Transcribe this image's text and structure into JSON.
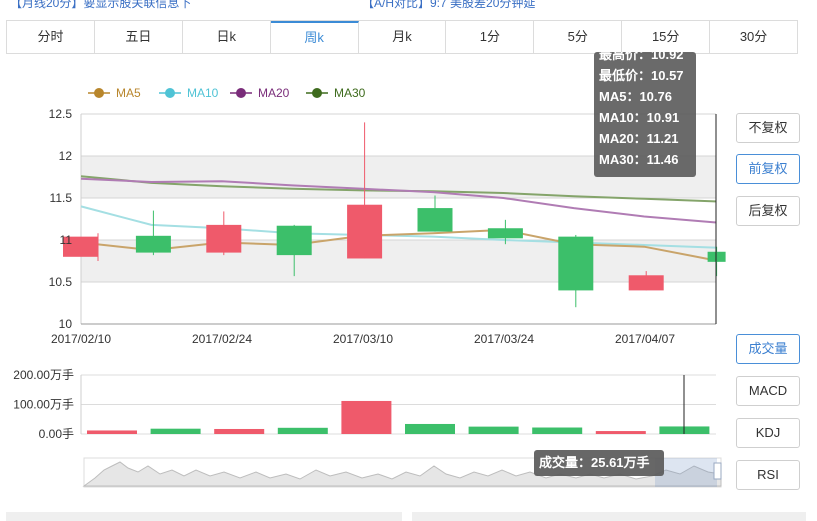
{
  "top_strip": {
    "left": "【月线20分】要显示股关联信息下",
    "right": "【A/H对比】9:7 美股差20分钟延"
  },
  "tabs": [
    "分时",
    "五日",
    "日k",
    "周k",
    "月k",
    "1分",
    "5分",
    "15分",
    "30分"
  ],
  "active_tab": 3,
  "side_buttons_top": [
    "不复权",
    "前复权",
    "后复权"
  ],
  "side_buttons_top_active": 1,
  "side_buttons_bottom": [
    "成交量",
    "MACD",
    "KDJ",
    "RSI"
  ],
  "side_buttons_bottom_active": 0,
  "tooltip": {
    "high": "最高价：10.92",
    "low": "最低价：10.57",
    "ma5": "MA5：10.76",
    "ma10": "MA10：10.91",
    "ma20": "MA20：11.21",
    "ma30": "MA30：11.46"
  },
  "volume_tooltip": "成交量：25.61万手",
  "colors": {
    "up": "#ef5a6b",
    "down": "#3cbf6a",
    "ma5": "#c9a46a",
    "ma10": "#a4dfe3",
    "ma20": "#b07cb4",
    "ma30": "#84a46a",
    "band": "#efefef"
  },
  "chart_data": {
    "type": "candlestick",
    "legend": [
      {
        "name": "MA5",
        "color": "#b8862c"
      },
      {
        "name": "MA10",
        "color": "#4fc3d5"
      },
      {
        "name": "MA20",
        "color": "#7a2d7a"
      },
      {
        "name": "MA30",
        "color": "#3e6b1d"
      }
    ],
    "legend_position": "top-left",
    "price_axis": {
      "ticks": [
        10,
        10.5,
        11,
        11.5,
        12,
        12.5
      ],
      "labels": [
        "10",
        "10.5",
        "11",
        "11.5",
        "12",
        "12.5"
      ],
      "ylim": [
        10,
        12.5
      ]
    },
    "date_labels": [
      "2017/02/10",
      "2017/02/24",
      "2017/03/10",
      "2017/03/24",
      "2017/04/07"
    ],
    "date_label_index": [
      0,
      2,
      4,
      6,
      8
    ],
    "candles": [
      {
        "open": 10.8,
        "close": 11.04,
        "high": 11.08,
        "low": 10.75
      },
      {
        "open": 11.05,
        "close": 10.85,
        "high": 11.35,
        "low": 10.82
      },
      {
        "open": 10.85,
        "close": 11.18,
        "high": 11.34,
        "low": 10.82
      },
      {
        "open": 11.17,
        "close": 10.82,
        "high": 11.18,
        "low": 10.57
      },
      {
        "open": 10.78,
        "close": 11.42,
        "high": 12.4,
        "low": 10.78
      },
      {
        "open": 11.38,
        "close": 11.1,
        "high": 11.53,
        "low": 11.1
      },
      {
        "open": 11.14,
        "close": 11.02,
        "high": 11.24,
        "low": 10.95
      },
      {
        "open": 11.04,
        "close": 10.4,
        "high": 11.06,
        "low": 10.2
      },
      {
        "open": 10.4,
        "close": 10.58,
        "high": 10.63,
        "low": 10.4
      },
      {
        "open": 10.86,
        "close": 10.74,
        "high": 10.92,
        "low": 10.57
      }
    ],
    "ma5": [
      10.97,
      10.88,
      10.97,
      10.94,
      11.05,
      11.08,
      11.12,
      10.95,
      10.92,
      10.76
    ],
    "ma10": [
      11.4,
      11.18,
      11.14,
      11.08,
      11.06,
      11.04,
      11.0,
      10.97,
      10.94,
      10.91
    ],
    "ma20": [
      11.73,
      11.69,
      11.7,
      11.65,
      11.61,
      11.57,
      11.5,
      11.38,
      11.28,
      11.21
    ],
    "ma30": [
      11.76,
      11.68,
      11.64,
      11.61,
      11.59,
      11.58,
      11.56,
      11.52,
      11.49,
      11.46
    ],
    "volume_axis": {
      "labels": [
        "200.00万手",
        "100.00万手",
        "0.00手"
      ],
      "values": [
        200,
        100,
        0
      ],
      "unit": "万手"
    },
    "volumes": [
      12,
      18,
      17,
      21,
      112,
      34,
      25,
      22,
      10,
      25.61
    ],
    "volume_direction": [
      "up",
      "down",
      "up",
      "down",
      "up",
      "down",
      "down",
      "down",
      "up",
      "down"
    ]
  }
}
